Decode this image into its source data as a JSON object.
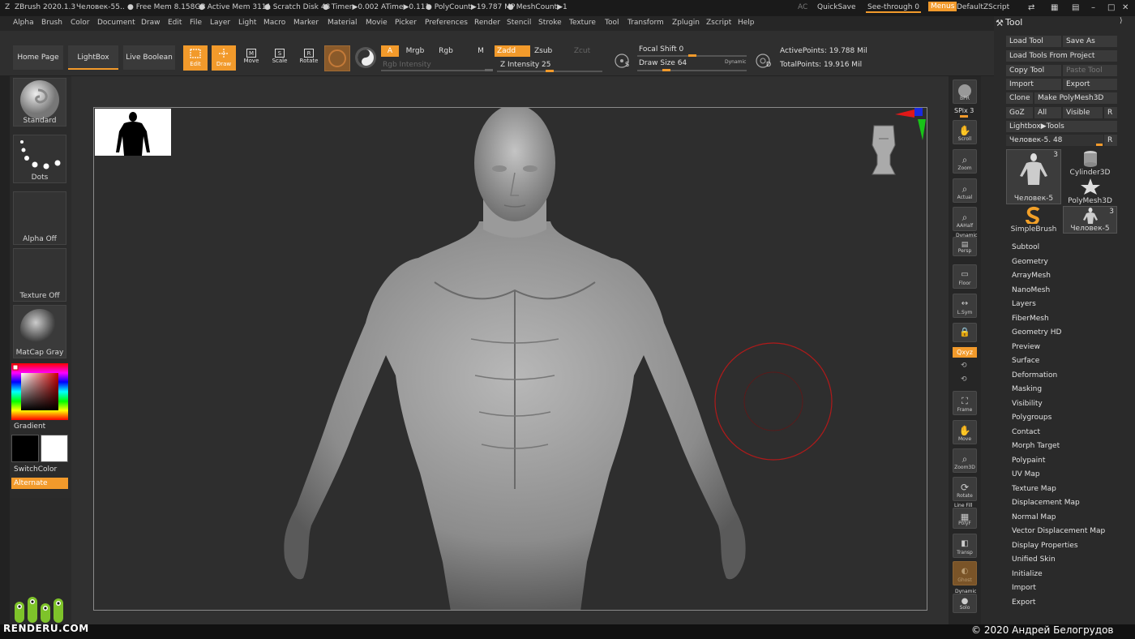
{
  "titlebar": {
    "app": "ZBrush 2020.1.3",
    "doc": "Человек-55",
    "ellipsis": "..",
    "freemem": "● Free Mem 8.158GB",
    "activemem": "● Active Mem 3111",
    "scratch": "● Scratch Disk 48",
    "timer": "● Timer▶0.002 ATime▶0.111",
    "polycount": "● PolyCount▶19.787 MP",
    "meshcount": "● MeshCount▶1",
    "ac": "AC",
    "quicksave": "QuickSave",
    "seethrough": "See-through  0",
    "menus": "Menus",
    "defaultzscript": "DefaultZScript"
  },
  "menu": [
    "Alpha",
    "Brush",
    "Color",
    "Document",
    "Draw",
    "Edit",
    "File",
    "Layer",
    "Light",
    "Macro",
    "Marker",
    "Material",
    "Movie",
    "Picker",
    "Preferences",
    "Render",
    "Stencil",
    "Stroke",
    "Texture",
    "Tool",
    "Transform",
    "Zplugin",
    "Zscript",
    "Help"
  ],
  "toolbar": {
    "home_page": "Home Page",
    "lightbox": "LightBox",
    "live_boolean": "Live Boolean",
    "edit": "Edit",
    "draw": "Draw",
    "move": "Move",
    "scale": "Scale",
    "rotate": "Rotate",
    "a": "A",
    "mrgb": "Mrgb",
    "rgb": "Rgb",
    "m": "M",
    "rgb_intensity": "Rgb Intensity",
    "zadd": "Zadd",
    "zsub": "Zsub",
    "zcut": "Zcut",
    "z_intensity": "Z Intensity 25",
    "focal_shift": "Focal Shift 0",
    "draw_size": "Draw Size 64",
    "dynamic": "Dynamic",
    "s_key": "S",
    "d_key": "D",
    "active_points": "ActivePoints: 19.788 Mil",
    "total_points": "TotalPoints: 19.916 Mil",
    "z_intensity_value": 0.25,
    "focal_shift_value": 0.5,
    "draw_size_value": 0.25
  },
  "leftshelf": {
    "brush": "Standard",
    "stroke": "Dots",
    "alpha": "Alpha Off",
    "texture": "Texture Off",
    "material": "MatCap Gray",
    "gradient": "Gradient",
    "switchcolor": "SwitchColor",
    "alternate": "Alternate"
  },
  "rightshelf": {
    "bpr": "BPR",
    "spix": "SPix 3",
    "scroll": "Scroll",
    "zoom": "Zoom",
    "actual": "Actual",
    "aahalf": "AAHalf",
    "dynamic": "Dynamic",
    "persp": "Persp",
    "floor": "Floor",
    "lsym": "L.Sym",
    "xyz": "Qxyz",
    "frame": "Frame",
    "move": "Move",
    "zoom3d": "Zoom3D",
    "rotate": "Rotate",
    "linefill": "Line Fill",
    "polyf": "PolyF",
    "transp": "Transp",
    "ghost": "Ghost",
    "solo": "Solo",
    "dynamic2": "Dynamic"
  },
  "tool": {
    "title": "Tool",
    "load_tool": "Load Tool",
    "save_as": "Save As",
    "load_from_project": "Load Tools From Project",
    "copy_tool": "Copy Tool",
    "paste_tool": "Paste Tool",
    "import": "Import",
    "export": "Export",
    "clone": "Clone",
    "make_polymesh": "Make PolyMesh3D",
    "goz": "GoZ",
    "all": "All",
    "visible": "Visible",
    "r": "R",
    "lightbox_tools": "Lightbox▶Tools",
    "current_tool": "Человек-5. 48",
    "r2": "R",
    "thumbs": {
      "t1_count": "3",
      "t1": "Человек-5",
      "t2": "Cylinder3D",
      "t3": "PolyMesh3D",
      "t4": "SimpleBrush",
      "t5": "Человек-5",
      "t5_count": "3"
    },
    "subpalettes": [
      "Subtool",
      "Geometry",
      "ArrayMesh",
      "NanoMesh",
      "Layers",
      "FiberMesh",
      "Geometry HD",
      "Preview",
      "Surface",
      "Deformation",
      "Masking",
      "Visibility",
      "Polygroups",
      "Contact",
      "Morph Target",
      "Polypaint",
      "UV Map",
      "Texture Map",
      "Displacement Map",
      "Normal Map",
      "Vector Displacement Map",
      "Display Properties",
      "Unified Skin",
      "Initialize",
      "Import",
      "Export"
    ]
  },
  "footer": {
    "logo": "RENDERU.COM",
    "copyright": "© 2020 Андрей Белогрудов"
  },
  "colors": {
    "accent": "#f29a2b",
    "brush_circle": "#b01a1a"
  }
}
